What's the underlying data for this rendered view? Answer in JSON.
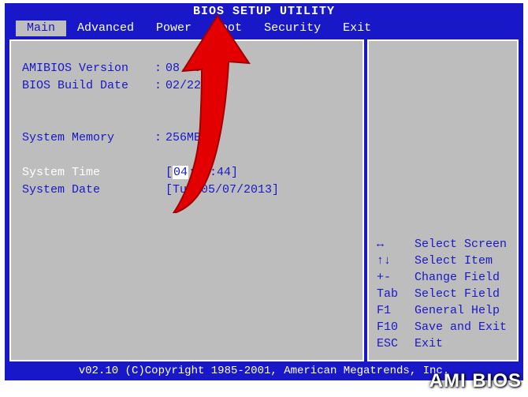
{
  "title": "BIOS SETUP UTILITY",
  "menu": {
    "items": [
      "Main",
      "Advanced",
      "Power",
      "Boot",
      "Security",
      "Exit"
    ],
    "selected_index": 0
  },
  "main_panel": {
    "bios_version_label": "AMIBIOS Version",
    "bios_version_value": "08.00.02",
    "build_date_label": "BIOS Build Date",
    "build_date_value": "02/22/06",
    "memory_label": "System Memory",
    "memory_value": "256MB",
    "time_label": "System Time",
    "time_hour": "04",
    "time_rest": ":50:44",
    "date_label": "System Date",
    "date_value": "[Tue 05/07/2013]",
    "colon": ":"
  },
  "help": [
    {
      "key": "↔",
      "desc": "Select Screen"
    },
    {
      "key": "↑↓",
      "desc": "Select Item"
    },
    {
      "key": "+-",
      "desc": "Change Field"
    },
    {
      "key": "Tab",
      "desc": "Select Field"
    },
    {
      "key": "F1",
      "desc": "General Help"
    },
    {
      "key": "F10",
      "desc": "Save and Exit"
    },
    {
      "key": "ESC",
      "desc": "Exit"
    }
  ],
  "footer": "v02.10 (C)Copyright 1985-2001, American Megatrends, Inc.",
  "watermark": "AMI BIOS",
  "overlay": {
    "arrow_color": "#e30000",
    "arrow_target": "boot-tab"
  }
}
